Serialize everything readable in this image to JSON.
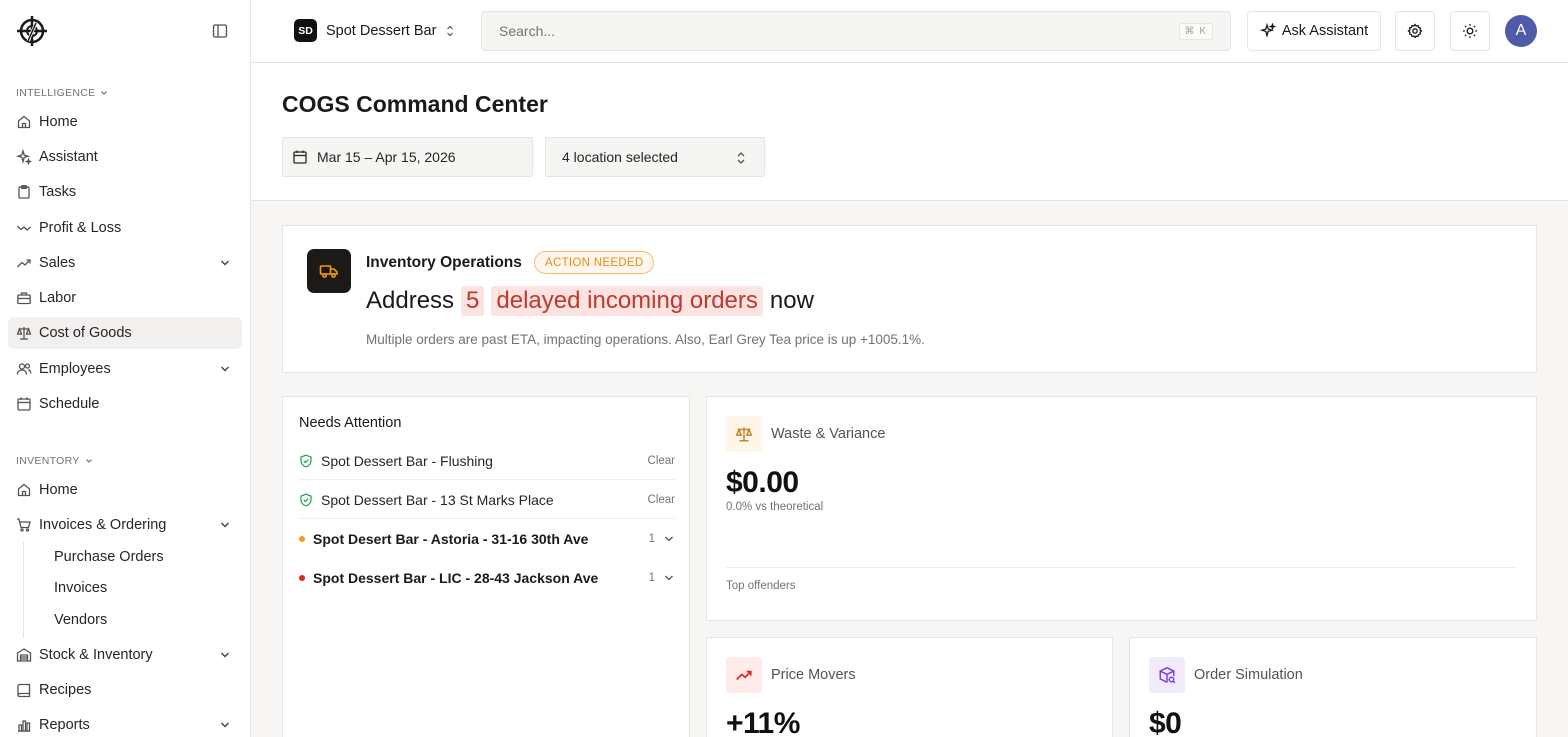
{
  "sidebar": {
    "sections": {
      "intelligence": "INTELLIGENCE",
      "inventory": "INVENTORY"
    },
    "intelligence_items": [
      {
        "label": "Home",
        "icon": "home-icon"
      },
      {
        "label": "Assistant",
        "icon": "sparkle-icon"
      },
      {
        "label": "Tasks",
        "icon": "clipboard-icon"
      },
      {
        "label": "Profit & Loss",
        "icon": "trend-icon"
      },
      {
        "label": "Sales",
        "icon": "trending-up-icon"
      },
      {
        "label": "Labor",
        "icon": "briefcase-icon"
      },
      {
        "label": "Cost of Goods",
        "icon": "scale-icon",
        "active": true
      },
      {
        "label": "Employees",
        "icon": "users-icon"
      },
      {
        "label": "Schedule",
        "icon": "calendar-icon"
      }
    ],
    "inventory_items": [
      {
        "label": "Home",
        "icon": "home-icon"
      },
      {
        "label": "Invoices & Ordering",
        "icon": "cart-icon"
      },
      {
        "label": "Stock & Inventory",
        "icon": "warehouse-icon"
      },
      {
        "label": "Recipes",
        "icon": "book-icon"
      },
      {
        "label": "Reports",
        "icon": "chart-icon"
      }
    ],
    "invoice_subitems": [
      "Purchase Orders",
      "Invoices",
      "Vendors"
    ]
  },
  "header": {
    "org_initials": "SD",
    "org_name": "Spot Dessert Bar",
    "search_placeholder": "Search...",
    "search_shortcut": "⌘ K",
    "ask_label": "Ask Assistant",
    "avatar_letter": "A"
  },
  "page": {
    "title": "COGS Command Center",
    "date_range": "Mar 15 – Apr 15, 2026",
    "location_filter": "4 location selected"
  },
  "alert": {
    "heading": "Inventory Operations",
    "badge": "ACTION NEEDED",
    "headline_prefix": "Address",
    "headline_count": "5",
    "headline_highlight": "delayed incoming orders",
    "headline_suffix": "now",
    "description": "Multiple orders are past ETA, impacting operations. Also, Earl Grey Tea price is up +1005.1%.",
    "icon_color": "#f59e0b"
  },
  "needs_attention": {
    "title": "Needs Attention",
    "rows": [
      {
        "name": "Spot Dessert Bar - Flushing",
        "status": "clear",
        "action": "Clear"
      },
      {
        "name": "Spot Dessert Bar - 13 St Marks Place",
        "status": "clear",
        "action": "Clear"
      },
      {
        "name": "Spot Desert Bar - Astoria - 31-16 30th Ave",
        "status": "warning",
        "count": "1",
        "color": "#f59e0b"
      },
      {
        "name": "Spot Dessert Bar - LIC - 28-43 Jackson Ave",
        "status": "critical",
        "count": "1",
        "color": "#dc2626"
      }
    ]
  },
  "waste": {
    "label": "Waste & Variance",
    "value": "$0.00",
    "sub": "0.0% vs theoretical",
    "footer": "Top offenders"
  },
  "price_movers": {
    "label": "Price Movers",
    "value": "+11%"
  },
  "order_sim": {
    "label": "Order Simulation",
    "value": "$0"
  }
}
